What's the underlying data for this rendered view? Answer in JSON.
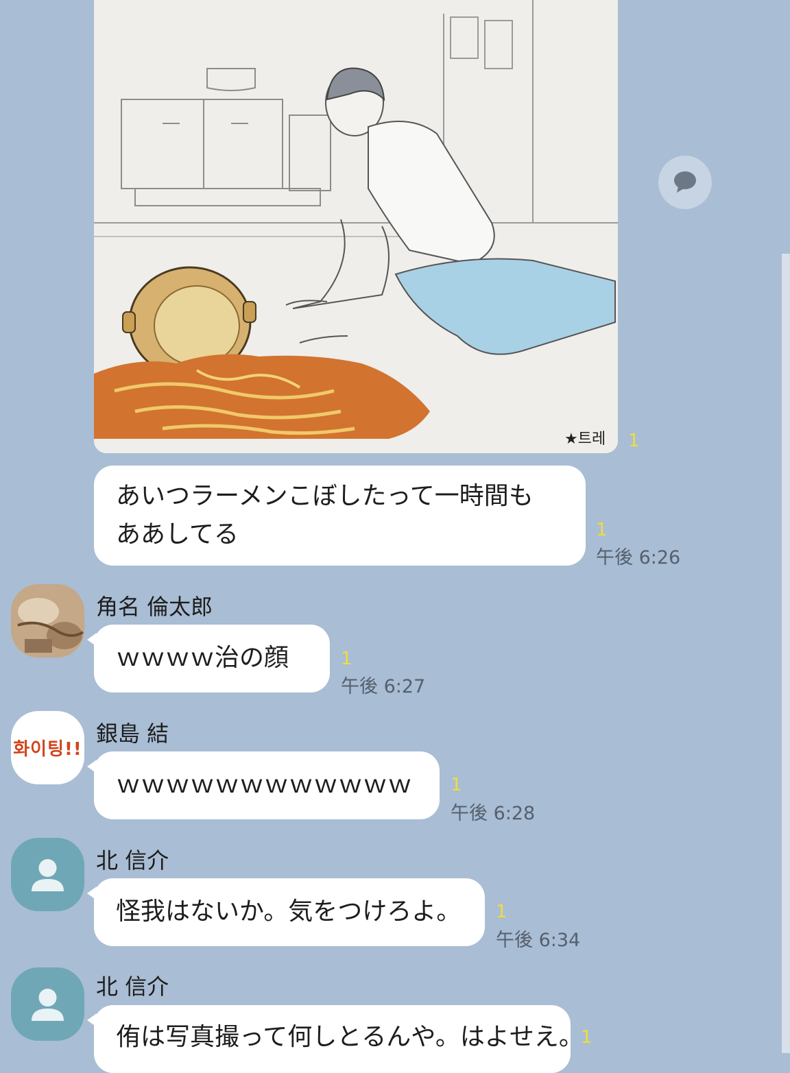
{
  "colors": {
    "background": "#a9bdd4",
    "bubble": "#ffffff",
    "read_count": "#f2dc3c",
    "timestamp": "#55606e"
  },
  "photo_message": {
    "signature": "★트레",
    "read_count": "1"
  },
  "messages": [
    {
      "sender": "",
      "avatar": "",
      "lines": [
        "あいつラーメンこぼしたって一時間も",
        "ああしてる"
      ],
      "read_count": "1",
      "time": "午後 6:26"
    },
    {
      "sender": "角名 倫太郎",
      "avatar": "photo",
      "lines": [
        "ｗｗｗｗ治の顔"
      ],
      "read_count": "1",
      "time": "午後 6:27"
    },
    {
      "sender": "銀島 結",
      "avatar": "화이팅!!",
      "lines": [
        "ｗｗｗｗｗｗｗｗｗｗｗｗ"
      ],
      "read_count": "1",
      "time": "午後 6:28"
    },
    {
      "sender": "北 信介",
      "avatar": "default-person-icon",
      "lines": [
        "怪我はないか。気をつけろよ。"
      ],
      "read_count": "1",
      "time": "午後 6:34"
    },
    {
      "sender": "北 信介",
      "avatar": "default-person-icon",
      "lines": [
        "侑は写真撮って何しとるんや。はよせえ。"
      ],
      "read_count": "1",
      "time": ""
    }
  ],
  "floating_button": {
    "icon": "speech-bubble-icon"
  }
}
